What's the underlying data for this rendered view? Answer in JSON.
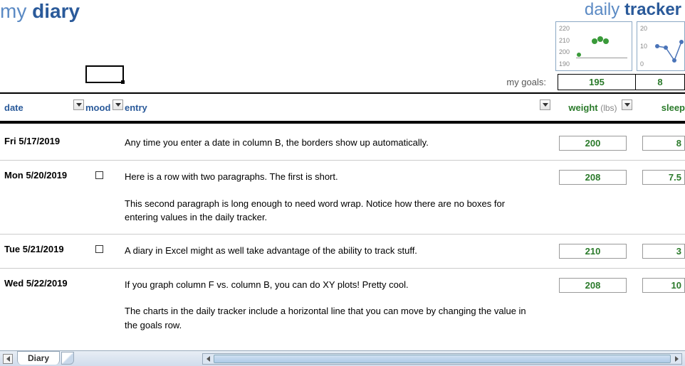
{
  "titles": {
    "diary_light": "my ",
    "diary_bold": "diary",
    "tracker_light": "daily ",
    "tracker_bold": "tracker"
  },
  "goals": {
    "label": "my goals:",
    "weight": "195",
    "sleep": "8"
  },
  "sparklines": {
    "weight": {
      "ticks": [
        "220",
        "210",
        "200",
        "190"
      ]
    },
    "sleep": {
      "ticks": [
        "20",
        "10",
        "0"
      ]
    }
  },
  "columns": {
    "date": "date",
    "mood": "mood",
    "entry": "entry",
    "weight": "weight",
    "weight_unit": "(lbs)",
    "sleep": "sleep"
  },
  "rows": [
    {
      "date": "Fri 5/17/2019",
      "mood_checkbox": false,
      "entry": [
        "Any time you enter a date in column B, the borders show up automatically."
      ],
      "weight": "200",
      "sleep": "8"
    },
    {
      "date": "Mon 5/20/2019",
      "mood_checkbox": true,
      "entry": [
        "Here is a row with two paragraphs. The first is short.",
        "This second paragraph is long enough to need word wrap. Notice how there are no boxes for entering values in the daily tracker."
      ],
      "weight": "208",
      "sleep": "7.5"
    },
    {
      "date": "Tue 5/21/2019",
      "mood_checkbox": true,
      "entry": [
        "A diary in Excel might as well take advantage of the ability to track stuff."
      ],
      "weight": "210",
      "sleep": "3"
    },
    {
      "date": "Wed 5/22/2019",
      "mood_checkbox": false,
      "entry": [
        "If you graph column F vs. column B, you can do XY plots! Pretty cool.",
        "The charts in the daily tracker include a horizontal line that you can move by changing the value in the goals row."
      ],
      "weight": "208",
      "sleep": "10"
    }
  ],
  "tab": {
    "name": "Diary"
  },
  "chart_data": [
    {
      "type": "scatter",
      "title": "weight sparkline",
      "ylim": [
        190,
        220
      ],
      "series": [
        {
          "name": "weight",
          "values": [
            200,
            208,
            210,
            208
          ]
        }
      ],
      "goal_line": 195
    },
    {
      "type": "scatter",
      "title": "sleep sparkline",
      "ylim": [
        0,
        20
      ],
      "series": [
        {
          "name": "sleep",
          "values": [
            8,
            7.5,
            3,
            10
          ]
        }
      ],
      "goal_line": 8
    }
  ]
}
